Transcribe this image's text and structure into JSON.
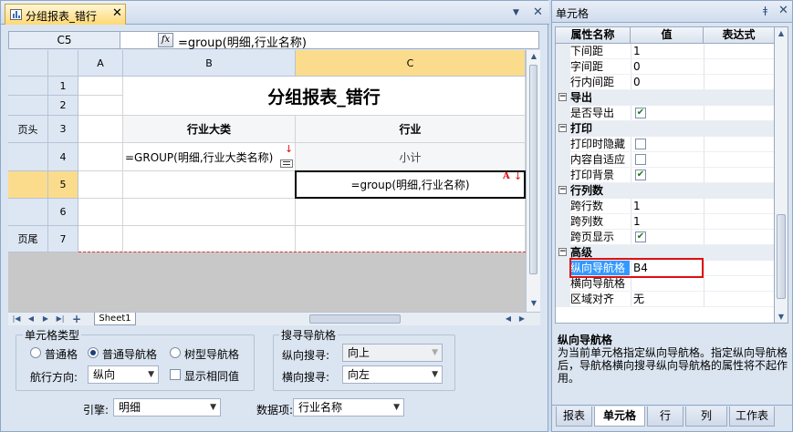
{
  "document_tab": {
    "title": "分组报表_错行"
  },
  "formula_bar": {
    "cell_ref": "C5",
    "fx_label": "fx",
    "formula": "=group(明细,行业名称)"
  },
  "grid": {
    "col_headers": [
      "A",
      "B",
      "C"
    ],
    "row_headers": [
      "1",
      "2",
      "3",
      "4",
      "5",
      "6",
      "7"
    ],
    "row_labels": {
      "r3": "页头",
      "r7": "页尾"
    },
    "title_cell": "分组报表_错行",
    "b3": "行业大类",
    "c3": "行业",
    "b4": "=GROUP(明细,行业大类名称)",
    "c4": "小计",
    "c5": "=group(明细,行业名称)",
    "c5_marker": "A"
  },
  "sheet_tabs": [
    "Sheet1"
  ],
  "cell_type": {
    "legend": "单元格类型",
    "options": [
      "普通格",
      "普通导航格",
      "树型导航格"
    ],
    "selected": "普通导航格",
    "direction_label": "航行方向:",
    "direction_value": "纵向",
    "show_same_label": "显示相同值"
  },
  "search_nav": {
    "legend": "搜寻导航格",
    "vertical_label": "纵向搜寻:",
    "vertical_value": "向上",
    "horizontal_label": "横向搜寻:",
    "horizontal_value": "向左"
  },
  "engine": {
    "label": "引擎:",
    "value": "明细"
  },
  "data_item": {
    "label": "数据项:",
    "value": "行业名称"
  },
  "property_panel": {
    "title": "单元格",
    "headers": [
      "属性名称",
      "值",
      "表达式"
    ],
    "rows": [
      {
        "kind": "prop",
        "name": "下间距",
        "value": "1"
      },
      {
        "kind": "prop",
        "name": "字间距",
        "value": "0"
      },
      {
        "kind": "prop",
        "name": "行内间距",
        "value": "0"
      },
      {
        "kind": "cat",
        "name": "导出"
      },
      {
        "kind": "check",
        "name": "是否导出",
        "checked": true
      },
      {
        "kind": "cat",
        "name": "打印"
      },
      {
        "kind": "check",
        "name": "打印时隐藏",
        "checked": false
      },
      {
        "kind": "check",
        "name": "内容自适应",
        "checked": false
      },
      {
        "kind": "check",
        "name": "打印背景",
        "checked": true
      },
      {
        "kind": "cat",
        "name": "行列数"
      },
      {
        "kind": "prop",
        "name": "跨行数",
        "value": "1"
      },
      {
        "kind": "prop",
        "name": "跨列数",
        "value": "1"
      },
      {
        "kind": "check",
        "name": "跨页显示",
        "checked": true
      },
      {
        "kind": "cat",
        "name": "高级"
      },
      {
        "kind": "prop",
        "name": "纵向导航格",
        "value": "B4",
        "selected": true
      },
      {
        "kind": "prop",
        "name": "横向导航格",
        "value": ""
      },
      {
        "kind": "prop",
        "name": "区域对齐",
        "value": "无"
      }
    ],
    "description_title": "纵向导航格",
    "description": "为当前单元格指定纵向导航格。指定纵向导航格后，导航格横向搜寻纵向导航格的属性将不起作用。",
    "tabs": [
      "报表",
      "单元格",
      "行",
      "列",
      "工作表"
    ],
    "active_tab": "单元格"
  },
  "colors": {
    "accent": "#3399ff",
    "highlight_border": "#e01010",
    "selection_header": "#fbdc8c"
  }
}
